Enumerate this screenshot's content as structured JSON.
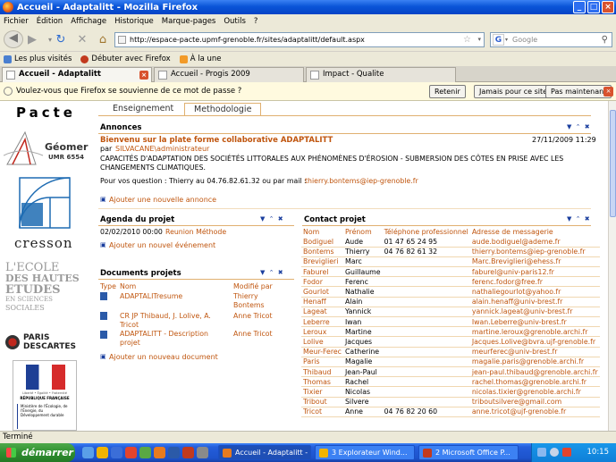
{
  "window": {
    "title": "Accueil - Adaptalitt - Mozilla Firefox"
  },
  "menu": [
    "Fichier",
    "Édition",
    "Affichage",
    "Historique",
    "Marque-pages",
    "Outils",
    "?"
  ],
  "nav": {
    "url": "http://espace-pacte.upmf-grenoble.fr/sites/adaptalitt/default.aspx",
    "search_placeholder": "Google"
  },
  "bookmarks": [
    "Les plus visités",
    "Débuter avec Firefox",
    "À la une"
  ],
  "tabs": [
    {
      "label": "Accueil - Adaptalitt"
    },
    {
      "label": "Accueil - Progis 2009"
    },
    {
      "label": "Impact - Qualite"
    }
  ],
  "password_bar": {
    "message": "Voulez-vous que Firefox se souvienne de ce mot de passe ?",
    "remember": "Retenir",
    "never": "Jamais pour ce site",
    "not_now": "Pas maintenant"
  },
  "sidebar": {
    "pacte": "Pacte",
    "geomer": "Géomer",
    "geomer_sub": "UMR 6554",
    "cresson": "cresson",
    "ecole_1": "L'ECOLE",
    "ecole_2": "DES HAUTES",
    "ecole_3": "ETUDES",
    "ecole_4": "EN SCIENCES",
    "ecole_5": "SOCIALES",
    "paris": "PARIS",
    "descartes": "DESCARTES",
    "rf_caption": "Liberté • Égalité • Fraternité",
    "rf_republique": "RÉPUBLIQUE FRANÇAISE",
    "rf_ministere": "Ministère de l'Écologie, de l'Énergie, du Développement durable"
  },
  "page_tabs": [
    "Enseignement",
    "Methodologie"
  ],
  "annonces": {
    "header": "Annonces",
    "title": "Bienvenu sur la plate forme collaborative ADAPTALITT",
    "by_prefix": "par",
    "author": "SILVACANE\\administrateur",
    "date": "27/11/2009 11:29",
    "body_1": "CAPACITÉS D'ADAPTATION DES SOCIÉTÉS LITTORALES AUX PHÉNOMÈNES D'ÉROSION - SUBMERSION DES CÔTES EN PRISE AVEC LES",
    "body_2": "CHANGEMENTS CLIMATIQUES.",
    "contact_text": "Pour vos question : Thierry au 04.76.82.61.32 ou par mail :",
    "contact_email": "thierry.bontems@iep-grenoble.fr",
    "add": "Ajouter une nouvelle annonce"
  },
  "agenda": {
    "header": "Agenda du projet",
    "date": "02/02/2010 00:00",
    "event": "Reunion Méthode",
    "add": "Ajouter un nouvel événement"
  },
  "documents": {
    "header": "Documents projets",
    "columns": [
      "Type",
      "Nom",
      "Modifié par"
    ],
    "rows": [
      {
        "name": "ADAPTALITresume",
        "by": "Thierry Bontems"
      },
      {
        "name": "CR JP Thibaud, J. Lolive, A. Tricot",
        "by": "Anne Tricot"
      },
      {
        "name": "ADAPTALITT - Description projet",
        "by": "Anne Tricot"
      }
    ],
    "add": "Ajouter un nouveau document"
  },
  "contacts": {
    "header": "Contact projet",
    "columns": [
      "Nom",
      "Prénom",
      "Téléphone professionnel",
      "Adresse de messagerie"
    ],
    "rows": [
      [
        "Bodiguel",
        "Aude",
        "01 47 65 24 95",
        "aude.bodiguel@ademe.fr"
      ],
      [
        "Bontems",
        "Thierry",
        "04 76 82 61 32",
        "thierry.bontems@iep-grenoble.fr"
      ],
      [
        "Breviglieri",
        "Marc",
        "",
        "Marc.Breviglieri@ehess.fr"
      ],
      [
        "Faburel",
        "Guillaume",
        "",
        "faburel@univ-paris12.fr"
      ],
      [
        "Fodor",
        "Ferenc",
        "",
        "ferenc.fodor@free.fr"
      ],
      [
        "Gourlot",
        "Nathalie",
        "",
        "nathaliegourlot@yahoo.fr"
      ],
      [
        "Henaff",
        "Alain",
        "",
        "alain.henaff@univ-brest.fr"
      ],
      [
        "Lageat",
        "Yannick",
        "",
        "yannick.lageat@univ-brest.fr"
      ],
      [
        "Leberre",
        "Iwan",
        "",
        "Iwan.Leberre@univ-brest.fr"
      ],
      [
        "Leroux",
        "Martine",
        "",
        "martine.leroux@grenoble.archi.fr"
      ],
      [
        "Lolive",
        "Jacques",
        "",
        "Jacques.Lolive@bvra.ujf-grenoble.fr"
      ],
      [
        "Meur-Ferec",
        "Catherine",
        "",
        "meurferec@univ-brest.fr"
      ],
      [
        "Paris",
        "Magalie",
        "",
        "magalie.paris@grenoble.archi.fr"
      ],
      [
        "Thibaud",
        "Jean-Paul",
        "",
        "jean-paul.thibaud@grenoble.archi.fr"
      ],
      [
        "Thomas",
        "Rachel",
        "",
        "rachel.thomas@grenoble.archi.fr"
      ],
      [
        "Tixier",
        "Nicolas",
        "",
        "nicolas.tixier@grenoble.archi.fr"
      ],
      [
        "Tribout",
        "Silvere",
        "",
        "triboutsilvere@gmail.com"
      ],
      [
        "Tricot",
        "Anne",
        "04 76 82 20 60",
        "anne.tricot@ujf-grenoble.fr"
      ]
    ]
  },
  "status": "Terminé",
  "taskbar": {
    "start": "démarrer",
    "items": [
      "Accueil - Adaptalitt - ...",
      "3 Explorateur Wind...",
      "2 Microsoft Office P..."
    ],
    "clock": "10:15"
  },
  "colors": {
    "accent_orange": "#c0560f",
    "link_blue": "#1a3e9e",
    "xp_blue": "#245edb"
  }
}
